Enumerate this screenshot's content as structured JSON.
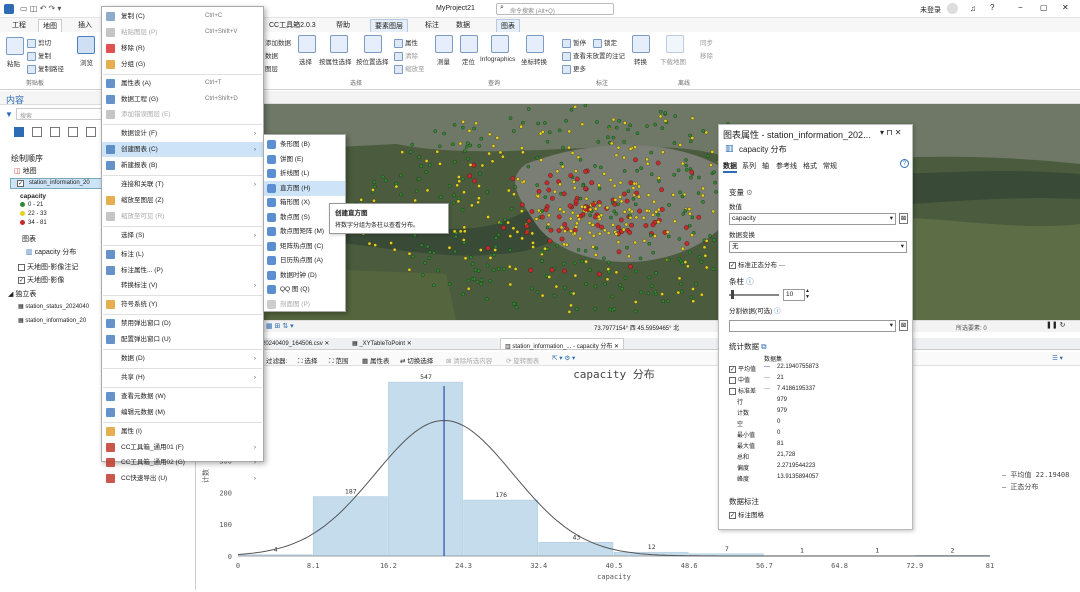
{
  "titlebar": {
    "project": "MyProject21",
    "search_placeholder": "命令搜索 (Alt+Q)",
    "user": "未登录"
  },
  "tabs": [
    "工程",
    "地图",
    "插入",
    "CC工具箱2.0.3",
    "帮助",
    "要素图层",
    "标注",
    "数据",
    "图表"
  ],
  "ribbon": {
    "paste": "粘贴",
    "cut": "剪切",
    "copy": "复制",
    "copy_path": "复制路径",
    "clipboard_group": "剪贴板",
    "explore": "浏览",
    "select": "选择",
    "select_by_attr": "按属性选择",
    "select_by_loc": "按位置选择",
    "attributes": "属性",
    "clear": "清除",
    "zoom_to_sel": "缩放至",
    "selection_group": "选择",
    "measure": "测量",
    "locate": "定位",
    "infographics": "Infographics",
    "coord_convert": "坐标转换",
    "query_group": "查询",
    "pause": "暂停",
    "lock": "锁定",
    "view_unplaced": "查看未放置的注记",
    "more": "更多",
    "label_group": "标注",
    "convert": "转换",
    "offline_download": "下载地图",
    "sync": "同步",
    "remove": "移除",
    "offline_group": "离线",
    "data_btn": "数据",
    "add_data": "添加数据",
    "layer": "图层"
  },
  "content_pane": {
    "title": "内容",
    "search_placeholder": "搜索",
    "draw_order": "绘制顺序",
    "map": "地图",
    "layer1": "station_information_20",
    "legend_field": "capacity",
    "legend": [
      {
        "label": "0 - 21",
        "color": "#2f8a2f"
      },
      {
        "label": "22 - 33",
        "color": "#e6d21d"
      },
      {
        "label": "34 - 81",
        "color": "#c62a2a"
      }
    ],
    "charts_label": "图表",
    "chart_item": "capacity 分布",
    "layer2": "天地图-影像注记",
    "layer3": "天地图-影像",
    "standalone": "独立表",
    "table1": "station_status_2024040",
    "table2": "station_information_20"
  },
  "context_menu": [
    {
      "label": "复制 (C)",
      "shortcut": "Ctrl+C",
      "color": "#7a9cc6"
    },
    {
      "label": "粘贴图层 (P)",
      "shortcut": "Ctrl+Shift+V",
      "disabled": true,
      "color": "#bbb"
    },
    {
      "label": "移除 (R)",
      "color": "#d33"
    },
    {
      "label": "分组 (G)",
      "color": "#e0a030"
    },
    {
      "sep": true
    },
    {
      "label": "属性表 (A)",
      "shortcut": "Ctrl+T",
      "color": "#4a7fc0"
    },
    {
      "label": "数据工程 (G)",
      "shortcut": "Ctrl+Shift+D",
      "color": "#4a7fc0"
    },
    {
      "label": "添加错误图层 (E)",
      "disabled": true,
      "color": "#bbb"
    },
    {
      "sep": true
    },
    {
      "label": "数据设计 (F)",
      "arrow": true
    },
    {
      "label": "创建图表 (C)",
      "arrow": true,
      "hl": true,
      "color": "#4a7fc0"
    },
    {
      "label": "新建报表 (B)",
      "color": "#4a7fc0"
    },
    {
      "sep": true
    },
    {
      "label": "连接和关联 (T)",
      "arrow": true
    },
    {
      "label": "缩放至图层 (Z)",
      "color": "#e0a030"
    },
    {
      "label": "缩放至可见 (R)",
      "disabled": true,
      "color": "#bbb"
    },
    {
      "sep": true
    },
    {
      "label": "选择 (S)",
      "arrow": true
    },
    {
      "sep": true
    },
    {
      "label": "标注 (L)",
      "color": "#4a7fc0"
    },
    {
      "label": "标注属性... (P)",
      "color": "#4a7fc0"
    },
    {
      "label": "转换标注 (V)",
      "arrow": true
    },
    {
      "sep": true
    },
    {
      "label": "符号系统 (Y)",
      "color": "#e0a030"
    },
    {
      "sep": true
    },
    {
      "label": "禁用弹出窗口 (D)",
      "color": "#4a7fc0"
    },
    {
      "label": "配置弹出窗口 (U)",
      "color": "#4a7fc0"
    },
    {
      "sep": true
    },
    {
      "label": "数据 (D)",
      "arrow": true
    },
    {
      "sep": true
    },
    {
      "label": "共享 (H)",
      "arrow": true
    },
    {
      "sep": true
    },
    {
      "label": "查看元数据 (W)",
      "color": "#4a7fc0"
    },
    {
      "label": "编辑元数据 (M)",
      "color": "#4a7fc0"
    },
    {
      "sep": true
    },
    {
      "label": "属性 (I)",
      "color": "#e0a030"
    },
    {
      "label": "CC工具箱_通用01 (F)",
      "arrow": true,
      "color": "#c0392b"
    },
    {
      "label": "CC工具箱_通用02 (G)",
      "arrow": true,
      "color": "#c0392b"
    },
    {
      "label": "CC快速导出 (U)",
      "arrow": true,
      "color": "#c0392b"
    }
  ],
  "submenu": [
    {
      "label": "条形图 (B)"
    },
    {
      "label": "饼图 (E)"
    },
    {
      "label": "折线图 (L)"
    },
    {
      "label": "直方图 (H)",
      "hl": true
    },
    {
      "label": "箱形图 (X)"
    },
    {
      "label": "散点图 (S)"
    },
    {
      "label": "散点图矩阵 (M)"
    },
    {
      "label": "矩阵热点图 (C)"
    },
    {
      "label": "日历热点图 (A)"
    },
    {
      "label": "数据时钟 (D)"
    },
    {
      "label": "QQ 图 (Q)"
    },
    {
      "label": "剖面图 (P)",
      "disabled": true
    }
  ],
  "tooltip": {
    "title": "创建直方图",
    "body": "将数字分组为条柱以查看分布。"
  },
  "map_status": {
    "coords": "73.7977154° 西 45.5959465° 北",
    "selected": "所选要素: 0"
  },
  "view_tabs": [
    "20240409_164506.csv",
    "_XYTableToPoint",
    "station_information_... - capacity 分布"
  ],
  "chart_toolbar": {
    "filter": "过滤器:",
    "select": "选择",
    "extent": "范围",
    "attr_table": "属性表",
    "switch_sel": "切换选择",
    "clear_sel": "清除所选内容",
    "rotate": "旋转图表"
  },
  "chart_data": {
    "type": "bar",
    "title": "capacity 分布",
    "xlabel": "capacity",
    "ylabel": "计数",
    "x_ticks": [
      "0",
      "8.1",
      "16.2",
      "24.3",
      "32.4",
      "40.5",
      "48.6",
      "56.7",
      "64.8",
      "72.9",
      "81"
    ],
    "y_ticks": [
      "0",
      "100",
      "200",
      "300"
    ],
    "ylim": [
      0,
      560
    ],
    "bins": [
      [
        0,
        8.1
      ],
      [
        8.1,
        16.2
      ],
      [
        16.2,
        24.3
      ],
      [
        24.3,
        32.4
      ],
      [
        32.4,
        40.5
      ],
      [
        40.5,
        48.6
      ],
      [
        48.6,
        56.7
      ],
      [
        56.7,
        64.8
      ],
      [
        64.8,
        72.9
      ],
      [
        72.9,
        81
      ]
    ],
    "values": [
      4,
      187,
      547,
      176,
      43,
      12,
      7,
      1,
      1,
      2
    ],
    "mean": 22.1940755873,
    "std": 7.4186195337,
    "n": 979,
    "legend_mean_label": "平均值",
    "legend_mean_value": "22.19408",
    "legend_normal_label": "正态分布"
  },
  "props_panel": {
    "title": "图表属性 - station_information_202...",
    "chart_name": "capacity 分布",
    "tabs": [
      "数据",
      "系列",
      "轴",
      "参考线",
      "格式",
      "常规"
    ],
    "variable_header": "变量",
    "number_label": "数值",
    "number_value": "capacity",
    "transform_label": "数据变换",
    "transform_value": "无",
    "normal_label": "标准正态分布",
    "bins_label": "条柱",
    "bins_value": "10",
    "split_label": "分割依据(可选)",
    "stats_header": "统计数据",
    "stats_col": "数据集",
    "mean_label": "平均值",
    "mean_value": "22.1940755873",
    "median_label": "中值",
    "median_value": "21",
    "std_label": "标准差",
    "std_value": "7.4186195337",
    "stats": [
      {
        "k": "行",
        "v": "979"
      },
      {
        "k": "计数",
        "v": "979"
      },
      {
        "k": "空",
        "v": "0"
      },
      {
        "k": "最小值",
        "v": "0"
      },
      {
        "k": "最大值",
        "v": "81"
      },
      {
        "k": "总和",
        "v": "21,728"
      },
      {
        "k": "偏度",
        "v": "2.2719544223"
      },
      {
        "k": "峰度",
        "v": "13.9135894057"
      }
    ],
    "labels_header": "数据标注",
    "labels_check": "标注图格"
  }
}
